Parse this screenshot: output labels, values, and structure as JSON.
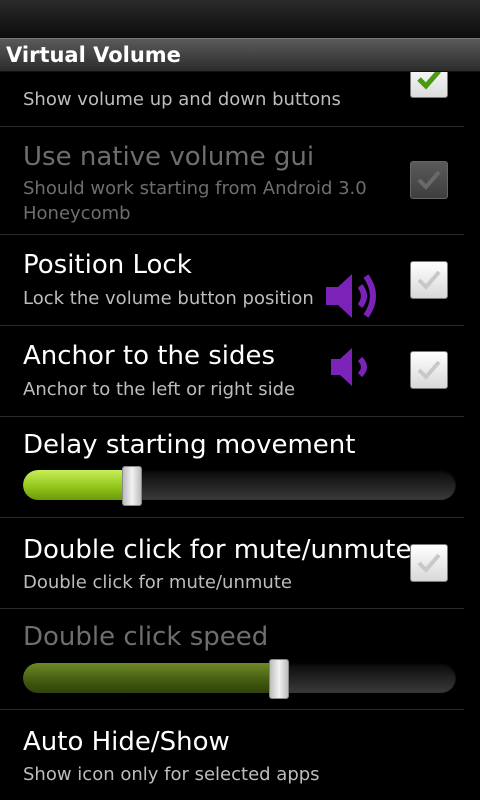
{
  "app": {
    "title": "Virtual Volume"
  },
  "items": [
    {
      "title": "",
      "summary": "Show volume up and down buttons",
      "checked": true
    },
    {
      "title": "Use native volume gui",
      "summary_line1": "Should work starting from Android 3.0",
      "summary_line2": "Honeycomb",
      "checked": true,
      "enabled": false
    },
    {
      "title": "Position Lock",
      "summary": "Lock the volume button position",
      "checked": true
    },
    {
      "title": "Anchor to the sides",
      "summary": "Anchor to the left or right side",
      "checked": true
    },
    {
      "title": "Delay starting movement",
      "slider_value": 0.25
    },
    {
      "title": "Double click for mute/unmute",
      "summary": "Double click for mute/unmute",
      "checked": true
    },
    {
      "title": "Double click speed",
      "slider_value": 0.59,
      "enabled": false
    },
    {
      "title": "Auto Hide/Show",
      "summary": "Show icon only for selected apps"
    }
  ],
  "colors": {
    "overlay_icon": "#7b22b8",
    "slider_fill": "#9fd21f"
  },
  "icons": {
    "overlay_large": "volume-loud-icon",
    "overlay_small": "volume-low-icon",
    "check": "check-icon"
  }
}
